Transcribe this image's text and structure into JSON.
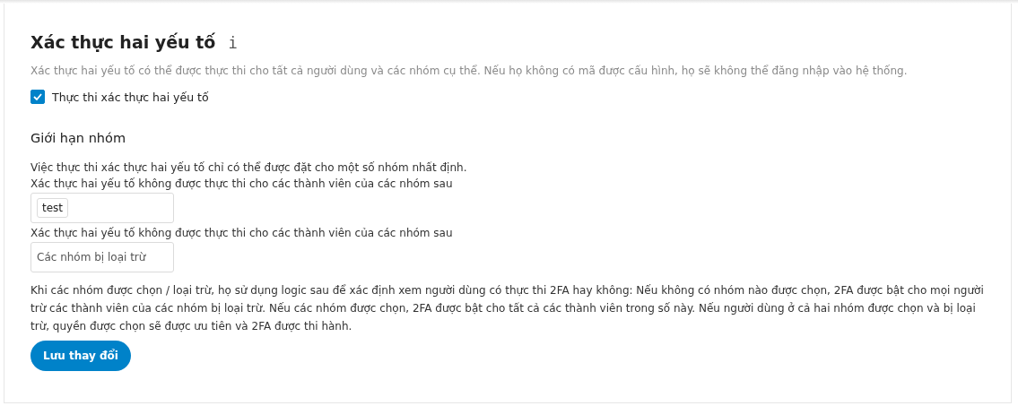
{
  "section": {
    "title": "Xác thực hai yếu tố",
    "info_icon": "i",
    "description": "Xác thực hai yếu tố có thể được thực thi cho tất cả người dùng và các nhóm cụ thể. Nếu họ không có mã được cấu hình, họ sẽ không thể đăng nhập vào hệ thống.",
    "enforce": {
      "label": "Thực thi xác thực hai yếu tố",
      "checked": true
    }
  },
  "group_limits": {
    "heading": "Giới hạn nhóm",
    "intro": "Việc thực thi xác thực hai yếu tố chỉ có thể được đặt cho một số nhóm nhất định.",
    "fields": [
      {
        "label": "Xác thực hai yếu tố không được thực thi cho các thành viên của các nhóm sau",
        "tags": [
          "test"
        ]
      },
      {
        "label": "Xác thực hai yếu tố không được thực thi cho các thành viên của các nhóm sau",
        "placeholder": "Các nhóm bị loại trừ"
      }
    ],
    "explanation": "Khi các nhóm được chọn / loại trừ, họ sử dụng logic sau để xác định xem người dùng có thực thi 2FA hay không: Nếu không có nhóm nào được chọn, 2FA được bật cho mọi người trừ các thành viên của các nhóm bị loại trừ. Nếu các nhóm được chọn, 2FA được bật cho tất cả các thành viên trong số này. Nếu người dùng ở cả hai nhóm được chọn và bị loại trừ, quyền được chọn sẽ được ưu tiên và 2FA được thi hành."
  },
  "save_button": "Lưu thay đổi"
}
